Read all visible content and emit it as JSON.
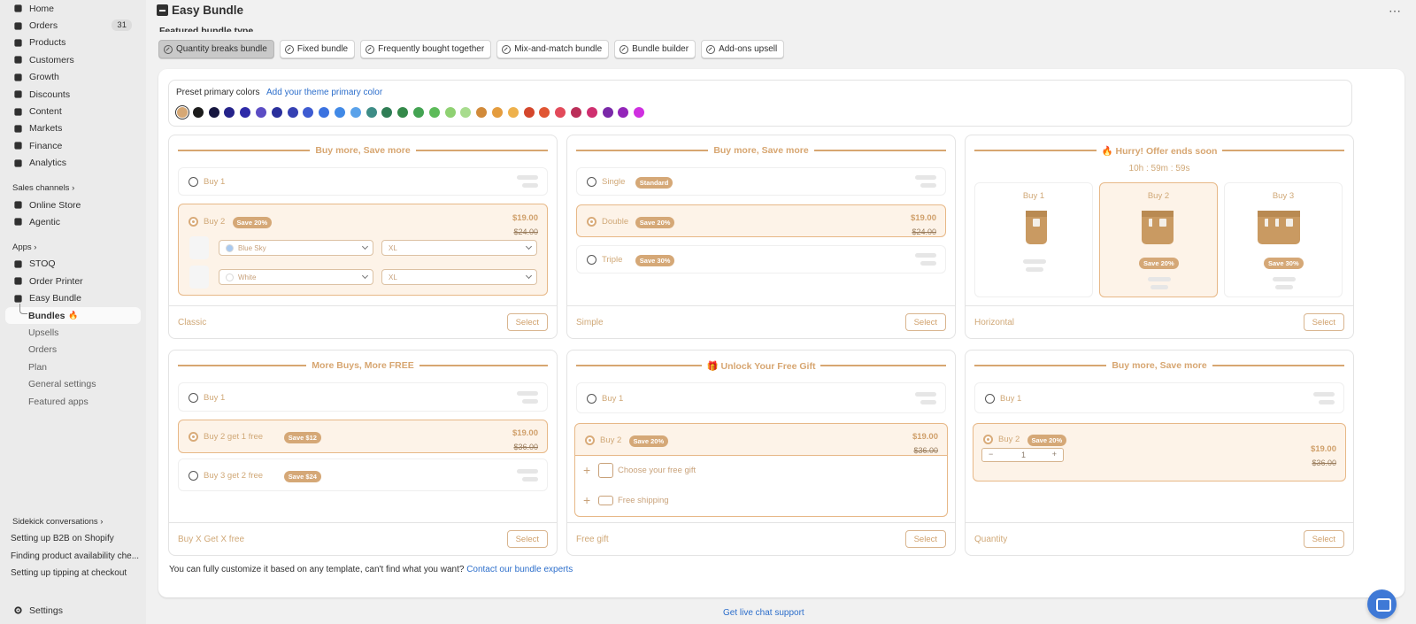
{
  "sidebar": {
    "nav": [
      {
        "label": "Home",
        "icon": "home-icon"
      },
      {
        "label": "Orders",
        "icon": "orders-icon",
        "badge": "31"
      },
      {
        "label": "Products",
        "icon": "tag-icon"
      },
      {
        "label": "Customers",
        "icon": "person-icon"
      },
      {
        "label": "Growth",
        "icon": "growth-icon"
      },
      {
        "label": "Discounts",
        "icon": "discount-icon"
      },
      {
        "label": "Content",
        "icon": "content-icon"
      },
      {
        "label": "Markets",
        "icon": "globe-icon"
      },
      {
        "label": "Finance",
        "icon": "bank-icon"
      },
      {
        "label": "Analytics",
        "icon": "chart-icon"
      }
    ],
    "sales_channels_label": "Sales channels",
    "channels": [
      {
        "label": "Online Store",
        "icon": "store-icon"
      },
      {
        "label": "Agentic",
        "icon": "agentic-icon"
      }
    ],
    "apps_label": "Apps",
    "apps": [
      {
        "label": "STOQ",
        "icon": "stoq-icon"
      },
      {
        "label": "Order Printer",
        "icon": "printer-icon"
      },
      {
        "label": "Easy Bundle",
        "icon": "bundle-icon"
      }
    ],
    "easy_bundle_sub": {
      "active": "Bundles",
      "items": [
        "Upsells",
        "Orders",
        "Plan",
        "General settings",
        "Featured apps"
      ]
    },
    "sidekick_label": "Sidekick conversations",
    "conversations": [
      "Setting up B2B on Shopify",
      "Finding product availability che...",
      "Setting up tipping at checkout"
    ],
    "settings_label": "Settings"
  },
  "header": {
    "title": "Easy Bundle",
    "more": "⋯"
  },
  "featured_title": "Featured bundle type",
  "tabs": [
    "Quantity breaks bundle",
    "Fixed bundle",
    "Frequently bought together",
    "Mix-and-match bundle",
    "Bundle builder",
    "Add-ons upsell"
  ],
  "preset": {
    "label": "Preset primary colors",
    "link": "Add your theme primary color",
    "colors": [
      "#d6a875",
      "#1c1c1c",
      "#16163f",
      "#25238a",
      "#2e2aa8",
      "#5b4cc4",
      "#2a2f9c",
      "#3540b3",
      "#3d5bd1",
      "#3b72e0",
      "#4189e6",
      "#5aa2ea",
      "#3d8c86",
      "#2f7d55",
      "#34894a",
      "#43a352",
      "#5dbb5a",
      "#8fd172",
      "#a8dc8e",
      "#d18a3a",
      "#e49c3e",
      "#eeb14c",
      "#d4472c",
      "#e05633",
      "#e24a5a",
      "#bb2f59",
      "#cf2f6f",
      "#7a28a8",
      "#9325b9",
      "#cf2fe0"
    ]
  },
  "templates": [
    {
      "header": "Buy more, Save more",
      "name": "Classic",
      "select": "Select",
      "options": [
        {
          "label": "Buy 1"
        },
        {
          "label": "Buy 2",
          "pill": "Save 20%",
          "price": "$19.00",
          "compare": "$24.00",
          "variants": [
            {
              "color": "Blue Sky",
              "size": "XL"
            },
            {
              "color": "White",
              "size": "XL"
            }
          ]
        }
      ]
    },
    {
      "header": "Buy more, Save more",
      "name": "Simple",
      "select": "Select",
      "options": [
        {
          "label": "Single",
          "pill": "Standard"
        },
        {
          "label": "Double",
          "pill": "Save 20%",
          "price": "$19.00",
          "compare": "$24.00"
        },
        {
          "label": "Triple",
          "pill": "Save 30%"
        }
      ]
    },
    {
      "header": "🔥 Hurry! Offer ends soon",
      "timer": "10h : 59m : 59s",
      "name": "Horizontal",
      "select": "Select",
      "options": [
        {
          "label": "Buy 1"
        },
        {
          "label": "Buy 2",
          "pill": "Save 20%"
        },
        {
          "label": "Buy 3",
          "pill": "Save 30%"
        }
      ]
    },
    {
      "header": "More Buys, More FREE",
      "name": "Buy X Get X free",
      "select": "Select",
      "options": [
        {
          "label": "Buy 1"
        },
        {
          "label": "Buy 2 get 1 free",
          "pill": "Save $12",
          "price": "$19.00",
          "compare": "$36.00"
        },
        {
          "label": "Buy 3 get 2 free",
          "pill": "Save $24"
        }
      ]
    },
    {
      "header": "🎁 Unlock Your Free Gift",
      "name": "Free gift",
      "select": "Select",
      "options": [
        {
          "label": "Buy 1"
        },
        {
          "label": "Buy 2",
          "pill": "Save 20%",
          "price": "$19.00",
          "compare": "$36.00"
        }
      ],
      "gifts": [
        "Choose your free gift",
        "Free shipping"
      ]
    },
    {
      "header": "Buy more, Save more",
      "name": "Quantity",
      "select": "Select",
      "options": [
        {
          "label": "Buy 1"
        },
        {
          "label": "Buy 2",
          "pill": "Save 20%",
          "price": "$19.00",
          "compare": "$36.00",
          "qty": "1"
        }
      ]
    }
  ],
  "footer_text": "You can fully customize it based on any template, can't find what you want?",
  "footer_link": "Contact our bundle experts",
  "live_chat": "Get live chat support"
}
